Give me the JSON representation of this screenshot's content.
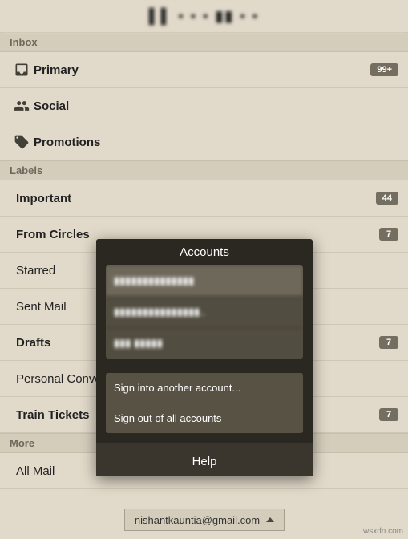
{
  "app": {
    "title": "▌▌ ▪ ▪ ▪ ▮▮ ▪ ▪"
  },
  "sections": {
    "inbox": "Inbox",
    "labels": "Labels",
    "more": "More"
  },
  "categories": [
    {
      "label": "Primary",
      "badge": "99+"
    },
    {
      "label": "Social"
    },
    {
      "label": "Promotions"
    }
  ],
  "labels": [
    {
      "label": "Important",
      "badge": "44",
      "bold": true
    },
    {
      "label": "From Circles",
      "badge": "7",
      "bold": true
    },
    {
      "label": "Starred"
    },
    {
      "label": "Sent Mail"
    },
    {
      "label": "Drafts",
      "badge": "7",
      "bold": true
    },
    {
      "label": "Personal Conversations"
    },
    {
      "label": "Train Tickets",
      "badge": "7",
      "bold": true
    }
  ],
  "more": [
    {
      "label": "All Mail"
    }
  ],
  "overlay": {
    "title": "Accounts",
    "accounts": [
      {
        "label": "▮▮▮▮▮▮▮▮▮▮▮▮▮▮"
      },
      {
        "label": "▮▮▮▮▮▮▮▮▮▮▮▮▮▮▮.."
      },
      {
        "label": "▮▮▮ ▮▮▮▮▮"
      }
    ],
    "sign_in": "Sign into another account...",
    "sign_out": "Sign out of all accounts",
    "help": "Help"
  },
  "chip": {
    "email": "nishantkauntia@gmail.com"
  },
  "watermark": "wsxdn.com"
}
